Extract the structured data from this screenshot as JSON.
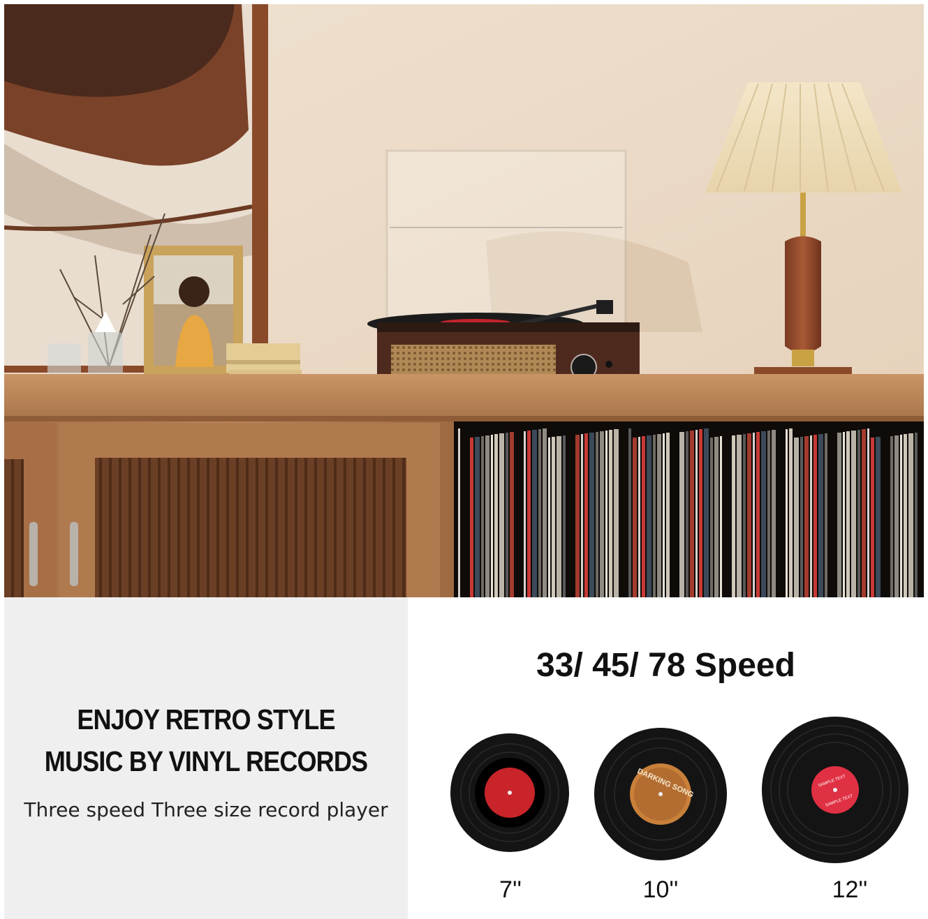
{
  "headline": {
    "line1": "ENJOY RETRO STYLE",
    "line2": "MUSIC BY VINYL RECORDS",
    "subtitle": "Three speed Three size record player"
  },
  "speeds": {
    "title": "33/ 45/ 78 Speed"
  },
  "records": [
    {
      "size": "7''",
      "label_color": "#c8242a",
      "label_text": ""
    },
    {
      "size": "10''",
      "label_color": "#c9803a",
      "label_text": "DARKING SONG"
    },
    {
      "size": "12''",
      "label_color": "#e03044",
      "label_text": "SAMPLE TEXT"
    }
  ],
  "colors": {
    "wall": "#ecdcc9",
    "wood": "#b88457",
    "left_panel_bg": "#efefef",
    "vinyl": "#141414"
  }
}
